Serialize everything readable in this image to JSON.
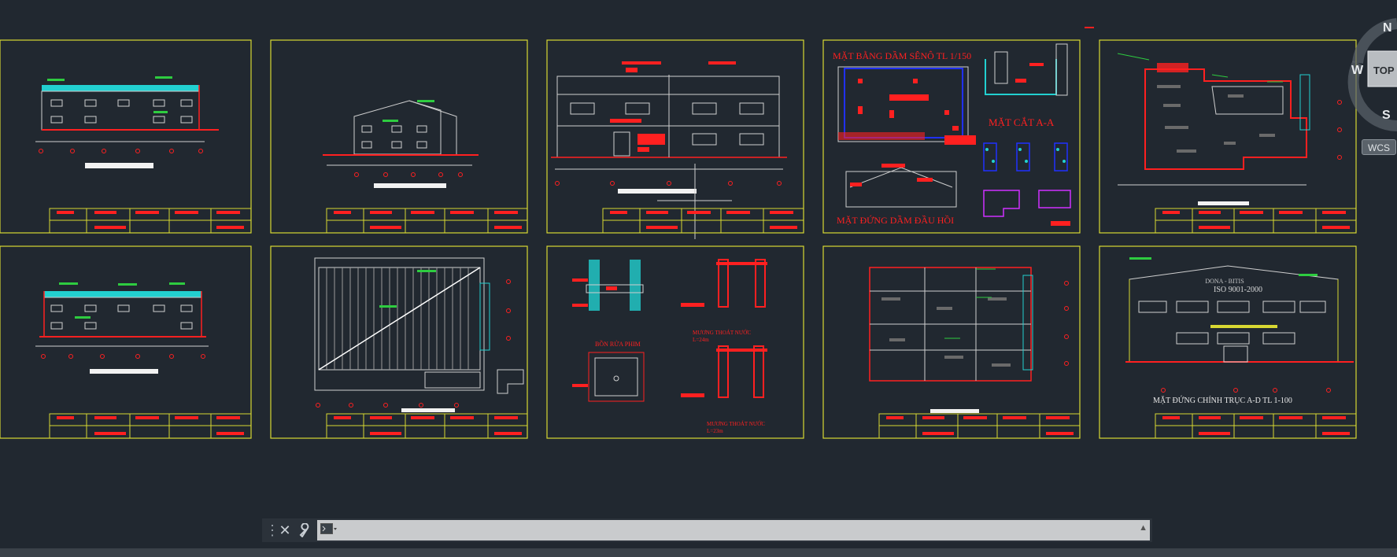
{
  "drawing": {
    "sheets": [
      {
        "id": "s1",
        "caption": ""
      },
      {
        "id": "s2",
        "caption": ""
      },
      {
        "id": "s3",
        "caption": ""
      },
      {
        "id": "s4",
        "caption_top": "MẶT BẰNG DẦM SÊNÔ TL 1/150",
        "caption_section": "MẶT CẮT A-A",
        "caption_bottom": "MẶT ĐỨNG DẦM ĐẦU HỒI"
      },
      {
        "id": "s5",
        "caption": ""
      },
      {
        "id": "s6",
        "caption": ""
      },
      {
        "id": "s7",
        "caption": ""
      },
      {
        "id": "s8",
        "caption_tank": "BỒN RỬA PHIM",
        "caption_drain1": "MƯƠNG THOÁT NƯỚC",
        "caption_drain1_len": "L=24m",
        "caption_drain2": "MƯƠNG THOÁT NƯỚC",
        "caption_drain2_len": "L=23m"
      },
      {
        "id": "s9",
        "caption": ""
      },
      {
        "id": "s10",
        "brand": "DONA - BITIS",
        "iso": "ISO 9001-2000",
        "caption": "MẶT ĐỨNG CHÍNH TRỤC A-D TL 1-100"
      }
    ]
  },
  "viewcube": {
    "north": "N",
    "west": "W",
    "south": "S",
    "face": "TOP",
    "wcs": "WCS"
  },
  "command_line": {
    "placeholder": "",
    "value": ""
  },
  "colors": {
    "background": "#212830",
    "frame": "#d8d832",
    "annotation": "#ff2020",
    "accent": "#22d0d0"
  },
  "icons": {
    "close": "close-icon",
    "customize": "wrench-icon",
    "prompt": "command-prompt-icon",
    "history": "chevron-up-icon"
  }
}
